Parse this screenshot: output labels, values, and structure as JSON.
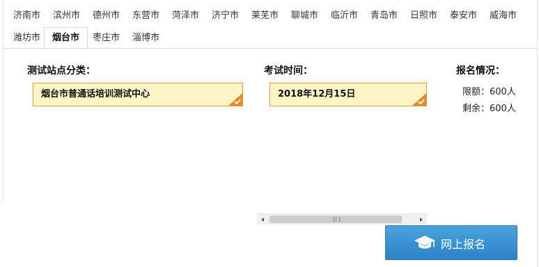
{
  "tabs": {
    "row1": [
      "济南市",
      "滨州市",
      "德州市",
      "东营市",
      "菏泽市",
      "济宁市",
      "莱芜市",
      "聊城市",
      "临沂市",
      "青岛市",
      "日照市",
      "泰安市",
      "威海市"
    ],
    "row2": [
      "潍坊市",
      "烟台市",
      "枣庄市",
      "淄博市"
    ],
    "active": "烟台市"
  },
  "site": {
    "label": "测试站点分类：",
    "value": "烟台市普通话培训测试中心"
  },
  "exam": {
    "label": "考试时间：",
    "value": "2018年12月15日"
  },
  "signup": {
    "label": "报名情况：",
    "quota_text": "限额：600人",
    "remaining_text": "剩余：600人"
  },
  "register_button": {
    "label": "网上报名",
    "icon": "graduation-cap-icon"
  },
  "colors": {
    "select_bg": "#fdf5c6",
    "select_border": "#e59a3a",
    "check_badge": "#e8862a",
    "button_top": "#4aa3dd",
    "button_bottom": "#2d82c6"
  }
}
